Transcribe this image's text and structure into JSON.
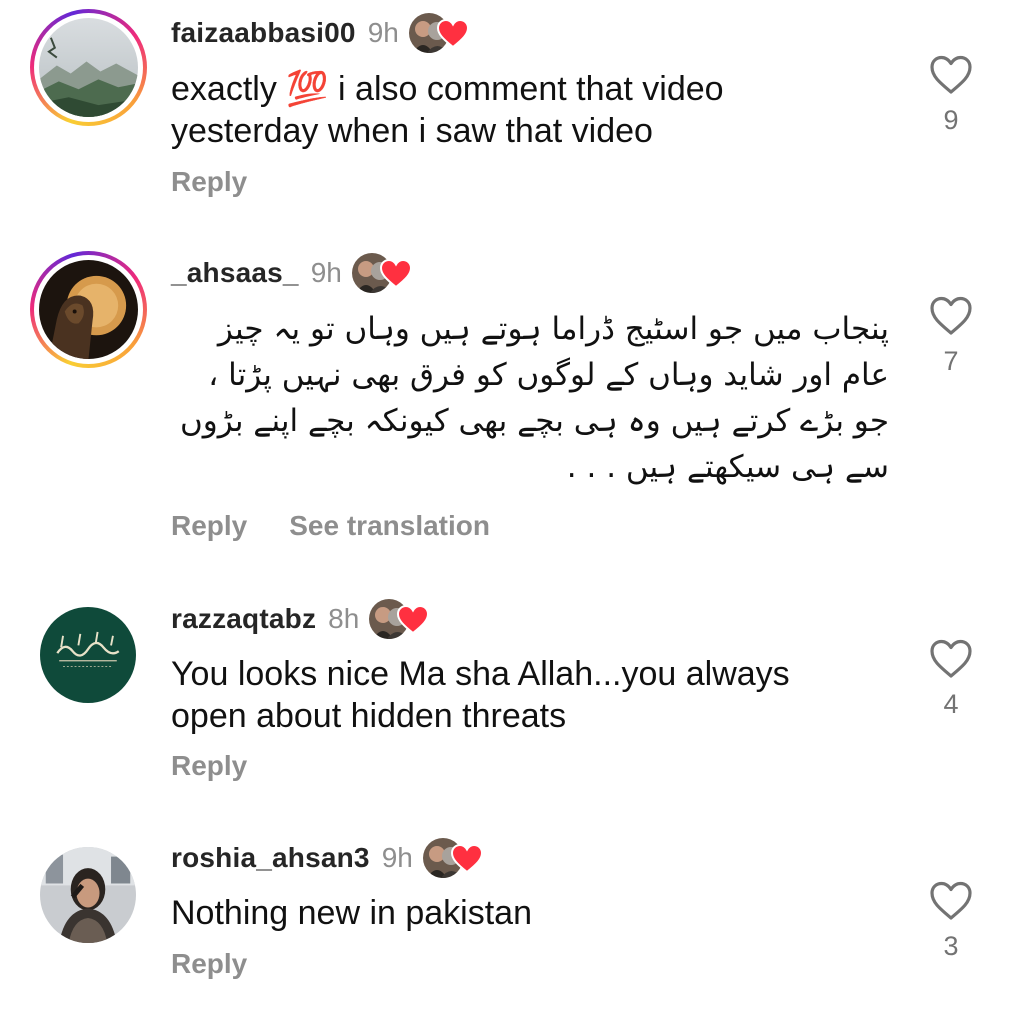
{
  "comments": [
    {
      "username": "faizaabbasi00",
      "time": "9h",
      "text": "exactly 💯 i also comment that video yesterday when i saw that video",
      "actions": [
        "Reply"
      ],
      "likes": "9",
      "avatar_icon": "mountain-landscape-avatar",
      "story_ring": true
    },
    {
      "username": "_ahsaas_",
      "time": "9h",
      "text": "پنجاب میں جو اسٹیج ڈراما ہوتے ہیں وہاں تو یہ چیز عام اور شاید وہاں کے لوگوں کو فرق بھی نہیں پڑتا ، جو بڑے کرتے ہیں وہ ہی بچے بھی کیونکہ بچے اپنے بڑوں سے ہی سیکھتے ہیں . . .",
      "actions": [
        "Reply",
        "See translation"
      ],
      "likes": "7",
      "avatar_icon": "lion-moon-avatar",
      "story_ring": true
    },
    {
      "username": "razzaqtabz",
      "time": "8h",
      "text": "You looks nice Ma sha Allah...you always open about hidden threats",
      "actions": [
        "Reply"
      ],
      "likes": "4",
      "avatar_icon": "calligraphy-avatar",
      "story_ring": false
    },
    {
      "username": "roshia_ahsan3",
      "time": "9h",
      "text": "Nothing new in pakistan",
      "actions": [
        "Reply"
      ],
      "likes": "3",
      "avatar_icon": "woman-photo-avatar",
      "story_ring": false
    }
  ],
  "colors": {
    "username": "#262626",
    "meta": "#8e8e8e",
    "heart_badge": "#ff3040",
    "text": "#111111"
  }
}
